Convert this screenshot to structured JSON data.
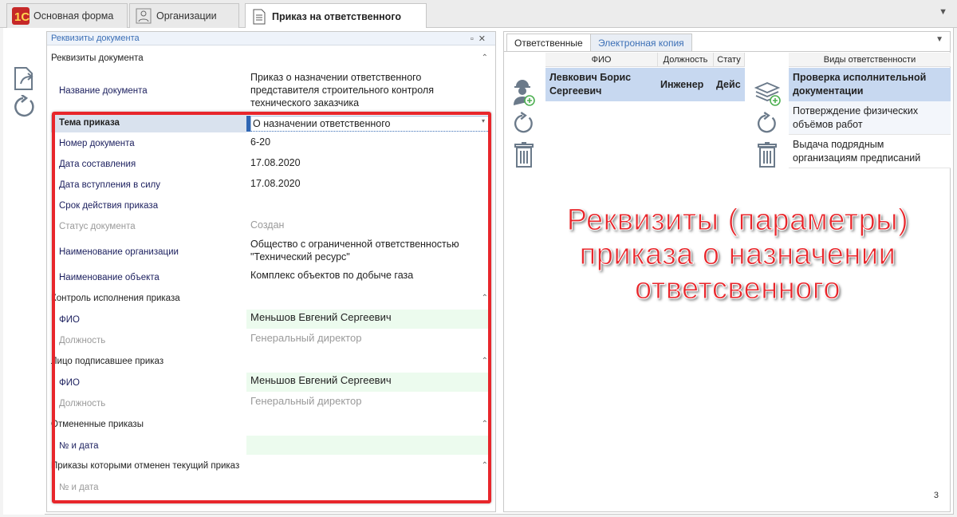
{
  "tabs": [
    {
      "label": "Основная форма",
      "icon": "1c-logo-icon"
    },
    {
      "label": "Организации",
      "icon": "organization-icon"
    },
    {
      "label": "Приказ на ответственного",
      "icon": "document-icon"
    }
  ],
  "doc_panel": {
    "title": "Реквизиты документа",
    "section1": "Реквизиты документа",
    "doc_name_label": "Название документа",
    "doc_name_value": [
      "Приказ о назначении ответственного",
      "представителя строительного контроля",
      "технического заказчика"
    ],
    "fields": [
      {
        "label": "Тема приказа",
        "value": "О назначении ответственного"
      },
      {
        "label": "Номер документа",
        "value": "6-20"
      },
      {
        "label": "Дата составления",
        "value": "17.08.2020"
      },
      {
        "label": "Дата вступления в силу",
        "value": "17.08.2020"
      },
      {
        "label": "Срок действия приказа",
        "value": ""
      },
      {
        "label": "Статус документа",
        "value": "Создан"
      }
    ],
    "org_label": "Наименование организации",
    "org_value": [
      "Общество с ограниченной ответственностью",
      "\"Технический ресурс\""
    ],
    "object_label": "Наименование объекта",
    "object_value": "Комплекс объектов по добыче газа",
    "section2": "Контроль исполнения приказа",
    "s2_fio_label": "ФИО",
    "s2_fio_value": "Меньшов Евгений Сергеевич",
    "s2_pos_label": "Должность",
    "s2_pos_value": "Генеральный директор",
    "section3": "Лицо подписавшее приказ",
    "s3_fio_label": "ФИО",
    "s3_fio_value": "Меньшов Евгений Сергеевич",
    "s3_pos_label": "Должность",
    "s3_pos_value": "Генеральный директор",
    "section4": "Отмененные приказы",
    "s4_label": "№ и дата",
    "section5": "Приказы которыми отменен текущий приказ",
    "s5_label": "№ и дата"
  },
  "right_panel": {
    "tabs": [
      "Ответственные",
      "Электронная копия"
    ],
    "grid1": {
      "columns": [
        "ФИО",
        "Должность",
        "Стату"
      ],
      "rows": [
        {
          "fio": [
            "Левкович Борис",
            "Сергеевич"
          ],
          "position": "Инженер",
          "status": "Дейс"
        }
      ]
    },
    "grid2": {
      "column": "Виды ответственности",
      "rows": [
        [
          "Проверка исполнительной",
          "документации"
        ],
        [
          "Потверждение физических",
          "объёмов работ"
        ],
        [
          "Выдача подрядным",
          "организациям предписаний"
        ]
      ]
    },
    "page_number": "3"
  },
  "annotation": [
    "Реквизиты (параметры)",
    "приказа о назначении",
    "ответсвенного"
  ],
  "colors": {
    "accent": "#e8262b",
    "selection": "#2f66b3",
    "row_selected": "#c7d8f0",
    "link": "#3b6fb6"
  }
}
